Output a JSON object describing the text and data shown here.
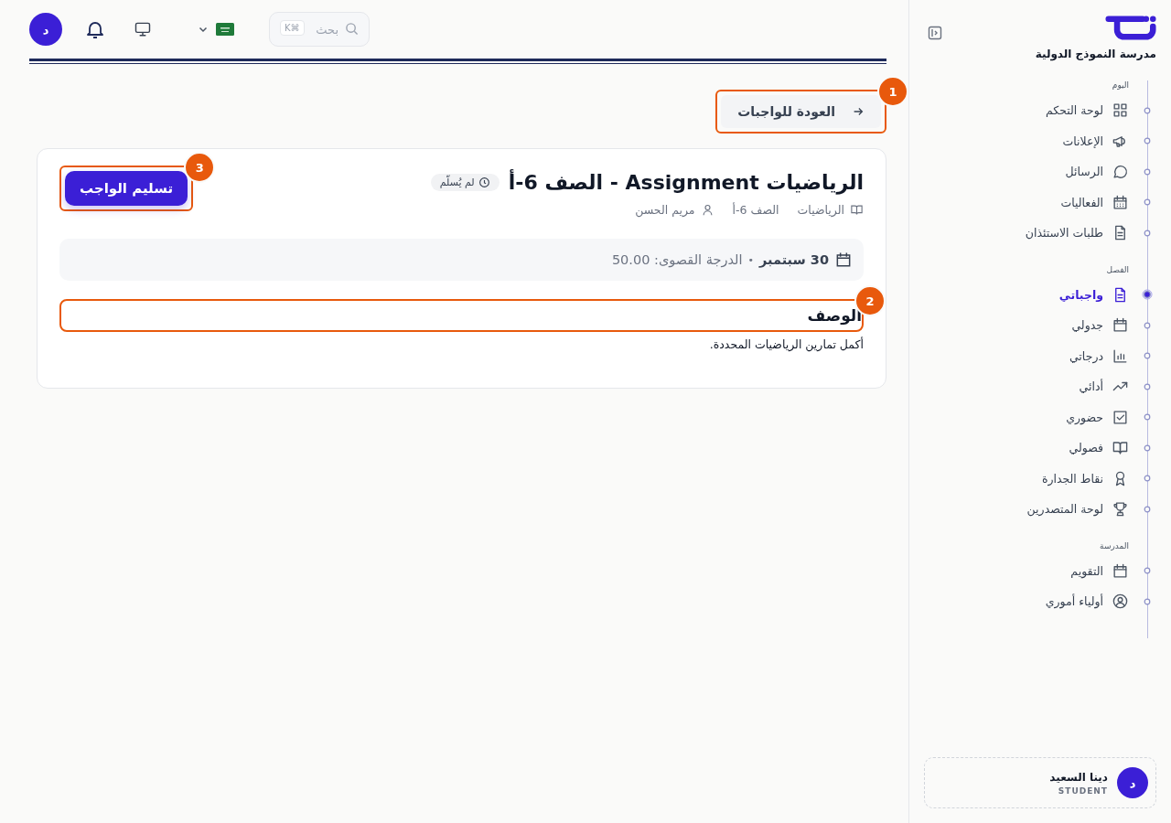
{
  "brand": {
    "school": "مدرسة النموذج الدولية"
  },
  "topbar": {
    "avatar": "د",
    "search": {
      "placeholder": "بحث",
      "shortcut": "K⌘"
    }
  },
  "back_button": {
    "label": "العودة للواجبات",
    "callout": "1"
  },
  "assignment": {
    "title": "الرياضيات Assignment - الصف 6-أ",
    "status": "لم يُسلّم",
    "subject": "الرياضيات",
    "class": "الصف 6-أ",
    "teacher": "مريم الحسن",
    "due": "30 سبتمبر",
    "separator": "•",
    "max_grade": "الدرجة القصوى: 50.00",
    "description_heading": "الوصف",
    "description_callout": "2",
    "description": "أكمل تمارين الرياضيات المحددة.",
    "submit": {
      "label": "تسليم الواجب",
      "callout": "3"
    }
  },
  "sidebar": {
    "sections": [
      {
        "title": "اليوم",
        "items": [
          {
            "label": "لوحة التحكم",
            "selected": false
          },
          {
            "label": "الإعلانات",
            "selected": false
          },
          {
            "label": "الرسائل",
            "selected": false
          },
          {
            "label": "الفعاليات",
            "selected": false
          },
          {
            "label": "طلبات الاستئذان",
            "selected": false
          }
        ]
      },
      {
        "title": "الفصل",
        "items": [
          {
            "label": "واجباتي",
            "selected": true
          },
          {
            "label": "جدولي",
            "selected": false
          },
          {
            "label": "درجاتي",
            "selected": false
          },
          {
            "label": "أدائي",
            "selected": false
          },
          {
            "label": "حضوري",
            "selected": false
          },
          {
            "label": "فصولي",
            "selected": false
          },
          {
            "label": "نقاط الجدارة",
            "selected": false
          },
          {
            "label": "لوحة المتصدرين",
            "selected": false
          }
        ]
      },
      {
        "title": "المدرسة",
        "items": [
          {
            "label": "التقويم",
            "selected": false
          },
          {
            "label": "أولياء أموري",
            "selected": false
          }
        ]
      }
    ]
  },
  "user": {
    "avatar": "د",
    "name": "دينا السعيد",
    "role": "STUDENT"
  }
}
